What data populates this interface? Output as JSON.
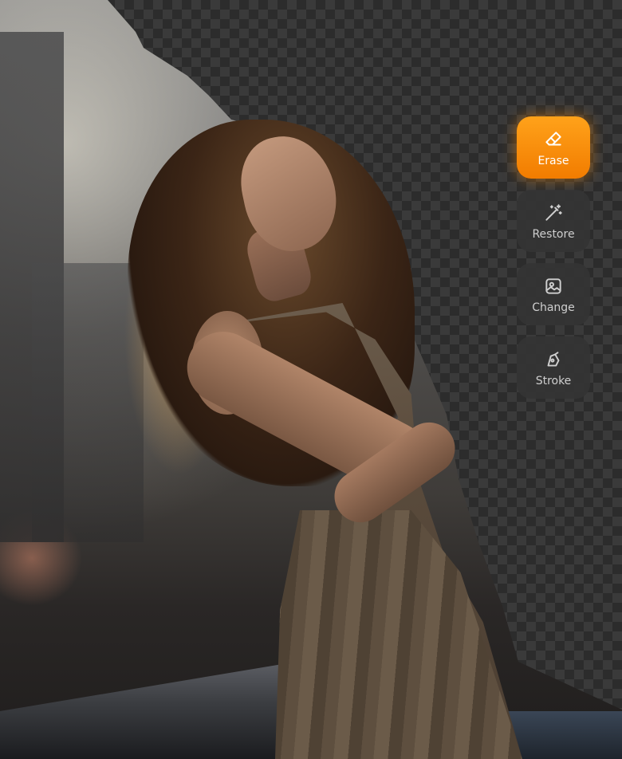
{
  "canvas": {
    "image_description_icon": "photo-with-background-partially-erased"
  },
  "tools": [
    {
      "label": "Erase",
      "icon": "eraser-icon",
      "active": true
    },
    {
      "label": "Restore",
      "icon": "magic-wand-icon",
      "active": false
    },
    {
      "label": "Change",
      "icon": "image-icon",
      "active": false
    },
    {
      "label": "Stroke",
      "icon": "stroke-pen-icon",
      "active": false
    }
  ],
  "colors": {
    "accent": "#F58A00",
    "tool_bg": "#343434",
    "checker_dark": "#2C2C2C",
    "checker_light": "#3A3A3A"
  }
}
